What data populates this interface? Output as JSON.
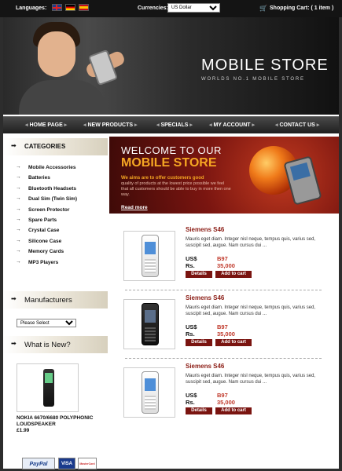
{
  "topbar": {
    "languages_label": "Languages:",
    "currencies_label": "Currencies:",
    "currency_value": "US Dollar",
    "cart_label": "Shopping Cart: ( 1 item )"
  },
  "header": {
    "title": "MOBILE STORE",
    "tagline": "WORLDS NO.1 MOBILE STORE"
  },
  "nav": [
    "HOME PAGE",
    "NEW PRODUCTS",
    "SPECIALS",
    "MY ACCOUNT",
    "CONTACT US"
  ],
  "sidebar": {
    "categories_title": "CATEGORIES",
    "categories": [
      "Mobile Accessories",
      "Batteries",
      "Bluetooth Headsets",
      "Dual Sim (Twin Sim)",
      "Screen Protector",
      "Spare Parts",
      "Crystal Case",
      "Silicone Case",
      "Memory Cards",
      "MP3 Players"
    ],
    "manufacturers_title": "Manufacturers",
    "manufacturer_select": "Please Select",
    "whatsnew_title": "What is New?",
    "new_product": {
      "name": "NOKIA 6670/6680 POLYPHONIC LOUDSPEAKER",
      "price": "£1.99"
    },
    "payments": [
      "PayPal",
      "VISA",
      "MasterCard"
    ]
  },
  "welcome": {
    "line1": "WELCOME TO OUR",
    "line2": "MOBILE STORE",
    "line3": "We aims are to offer customers good",
    "body": "quality of products at the lowest price possible we feel that all customers should be able to buy in more then one way.",
    "read_more": "Read more"
  },
  "products": [
    {
      "name": "Siemens S46",
      "desc": "Mauris eget diam. Integer nisl neque, tempus quis, varius sed, suscipit sed, augue. Nam cursus dui ...",
      "usd_label": "US$",
      "usd": "B97",
      "rs_label": "Rs.",
      "rs": "35,000",
      "details": "Details",
      "add": "Add to cart"
    },
    {
      "name": "Siemens S46",
      "desc": "Mauris eget diam. Integer nisl neque, tempus quis, varius sed, suscipit sed, augue. Nam cursus dui ...",
      "usd_label": "US$",
      "usd": "B97",
      "rs_label": "Rs.",
      "rs": "35,000",
      "details": "Details",
      "add": "Add to cart"
    },
    {
      "name": "Siemens S46",
      "desc": "Mauris eget diam. Integer nisl neque, tempus quis, varius sed, suscipit sed, augue. Nam cursus dui ...",
      "usd_label": "US$",
      "usd": "B97",
      "rs_label": "Rs.",
      "rs": "35,000",
      "details": "Details",
      "add": "Add to cart"
    }
  ],
  "colors": {
    "accent": "#7a1410",
    "price": "#c0392b",
    "header_bg": "#141414"
  }
}
